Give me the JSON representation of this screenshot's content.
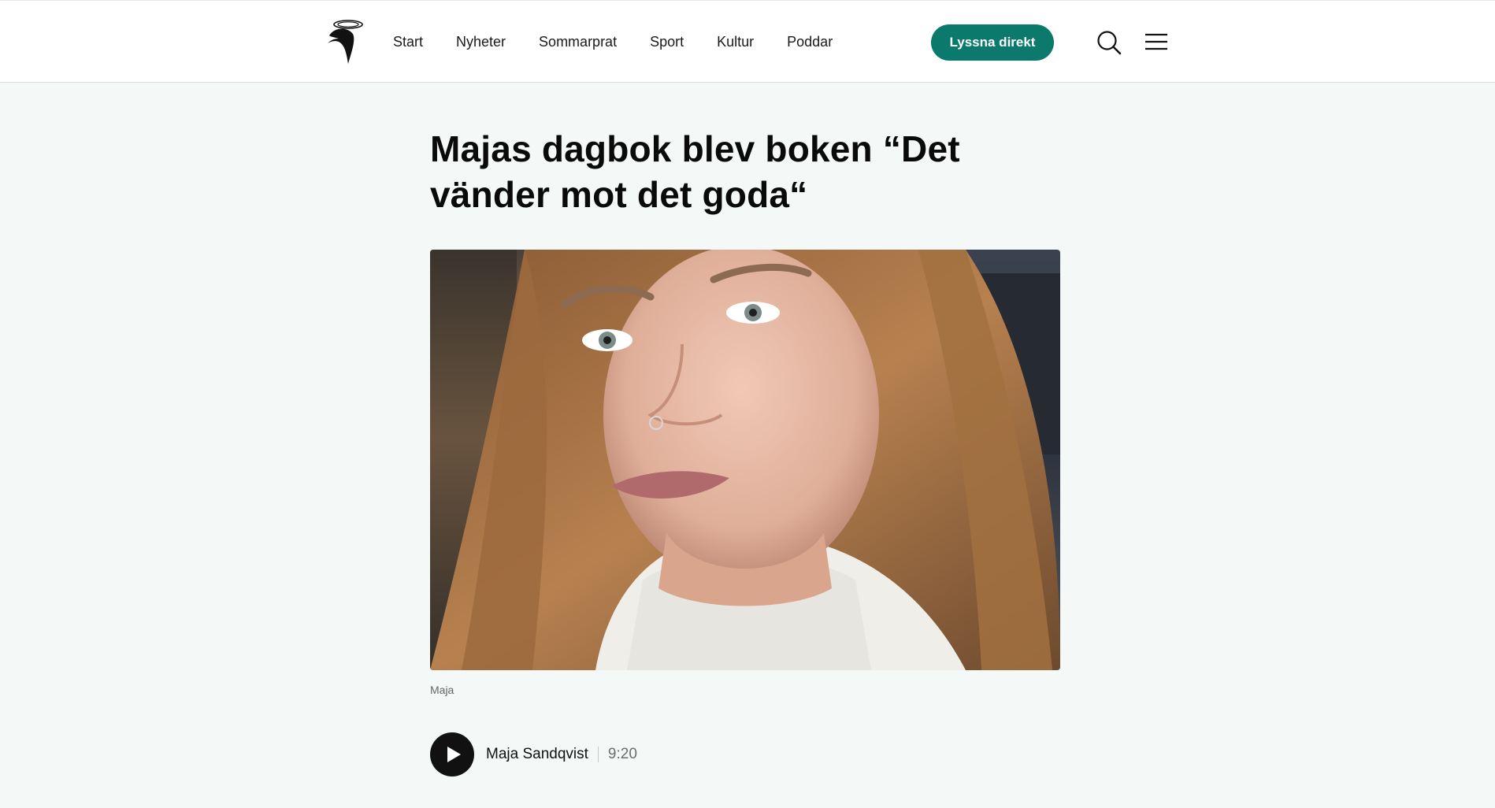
{
  "header": {
    "nav": [
      "Start",
      "Nyheter",
      "Sommarprat",
      "Sport",
      "Kultur",
      "Poddar"
    ],
    "listen_label": "Lyssna direkt",
    "accent": "#0b7a6c"
  },
  "article": {
    "title": "Majas dagbok blev boken “Det vänder mot det goda“",
    "image_caption": "Maja"
  },
  "player": {
    "episode": "Maja Sandqvist",
    "duration": "9:20"
  }
}
